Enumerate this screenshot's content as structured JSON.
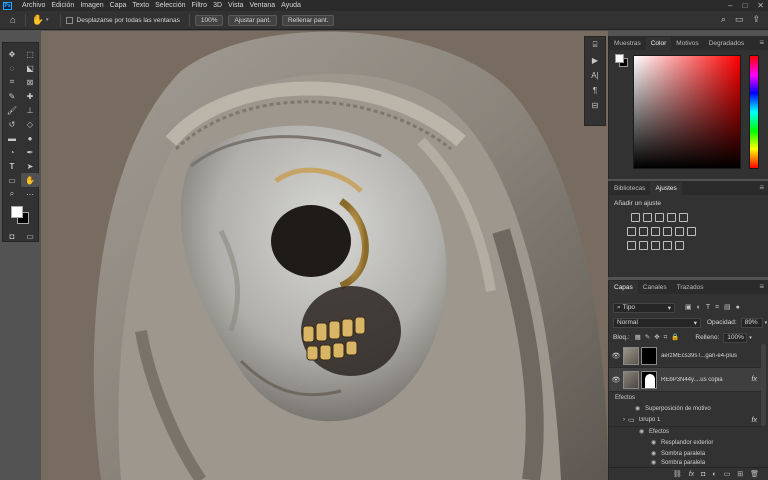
{
  "menu": {
    "logo": "Ps",
    "items": [
      "Archivo",
      "Edición",
      "Imagen",
      "Capa",
      "Texto",
      "Selección",
      "Filtro",
      "3D",
      "Vista",
      "Ventana",
      "Ayuda"
    ],
    "window_controls": [
      "–",
      "□",
      "✕"
    ]
  },
  "options": {
    "scroll_all_label": "Desplazarse por todas las ventanas",
    "zoom_value": "100%",
    "fit_screen": "Ajustar pant.",
    "fill_screen": "Rellenar pant."
  },
  "color_panel": {
    "tabs": [
      "Muestras",
      "Color",
      "Motivos",
      "Degradados"
    ],
    "active_tab": "Color"
  },
  "adjustments_panel": {
    "tabs": [
      "Bibliotecas",
      "Ajustes"
    ],
    "active_tab": "Ajustes",
    "title": "Añadir un ajuste"
  },
  "layers_panel": {
    "tabs": [
      "Capas",
      "Canales",
      "Trazados"
    ],
    "active_tab": "Capas",
    "filter_kind": "Tipo",
    "blend_mode": "Normal",
    "opacity_label": "Opacidad:",
    "opacity_value": "89%",
    "lock_label": "Bloq.:",
    "fill_label": "Relleno:",
    "fill_value": "100%",
    "layers": [
      {
        "name": "aerzMEcs39sT...gan-e4-plus"
      },
      {
        "name": "REbP3N44y....us copia",
        "fx": "fx"
      }
    ],
    "effects_label": "Efectos",
    "effect_1": "Superposición de motivo",
    "group_name": "Grupo 1",
    "group_fx": "fx",
    "group_effects_label": "Efectos",
    "group_effects": [
      "Resplandor exterior",
      "Sombra paralela",
      "Sombra paralela"
    ]
  }
}
